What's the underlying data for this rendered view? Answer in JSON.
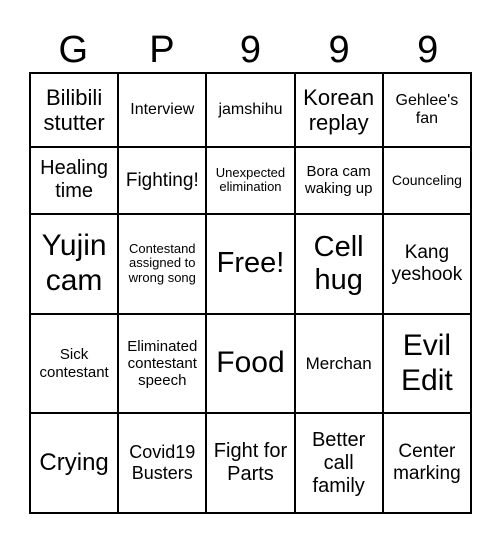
{
  "header": [
    "G",
    "P",
    "9",
    "9",
    "9"
  ],
  "cells": [
    [
      "Bilibili stutter",
      "Interview",
      "jamshihu",
      "Korean replay",
      "Gehlee's fan"
    ],
    [
      "Healing time",
      "Fighting!",
      "Unexpected elimination",
      "Bora cam waking up",
      "Counceling"
    ],
    [
      "Yujin cam",
      "Contestand assigned to wrong song",
      "Free!",
      "Cell hug",
      "Kang yeshook"
    ],
    [
      "Sick contestant",
      "Eliminated contestant speech",
      "Food",
      "Merchan",
      "Evil Edit"
    ],
    [
      "Crying",
      "Covid19 Busters",
      "Fight for Parts",
      "Better call family",
      "Center marking"
    ]
  ]
}
